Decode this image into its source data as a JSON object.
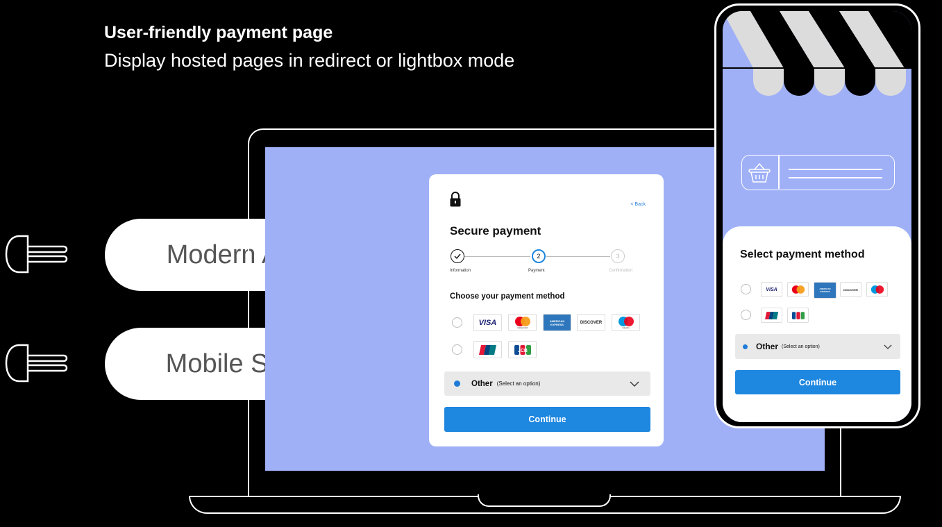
{
  "header": {
    "title": "User-friendly payment page",
    "subtitle": "Display hosted pages in redirect or lightbox mode"
  },
  "features": [
    {
      "label": "Modern API",
      "icon": "plug-icon"
    },
    {
      "label": "Mobile SDK",
      "icon": "plug-icon"
    }
  ],
  "desktop_form": {
    "back_link": "< Back",
    "title": "Secure payment",
    "steps": [
      {
        "number": "✓",
        "label": "Information",
        "state": "done"
      },
      {
        "number": "2",
        "label": "Payment",
        "state": "active"
      },
      {
        "number": "3",
        "label": "Confirmation",
        "state": "pending"
      }
    ],
    "choose_label": "Choose your payment method",
    "card_row_1": [
      "VISA",
      "mastercard",
      "AMERICAN EXPRESS",
      "DISCOVER",
      "maestro"
    ],
    "card_row_2": [
      "UnionPay",
      "JCB"
    ],
    "other_label": "Other",
    "other_hint": "(Select an option)",
    "continue_label": "Continue"
  },
  "mobile_form": {
    "title": "Select payment method",
    "card_row_1": [
      "VISA",
      "mastercard",
      "AMERICAN EXPRESS",
      "DISCOVER",
      "maestro"
    ],
    "card_row_2": [
      "UnionPay",
      "JCB"
    ],
    "other_label": "Other",
    "other_hint": "(Select an option)",
    "continue_label": "Continue"
  },
  "colors": {
    "background": "#000000",
    "screen": "#9fb0f7",
    "accent": "#1e87e0"
  }
}
